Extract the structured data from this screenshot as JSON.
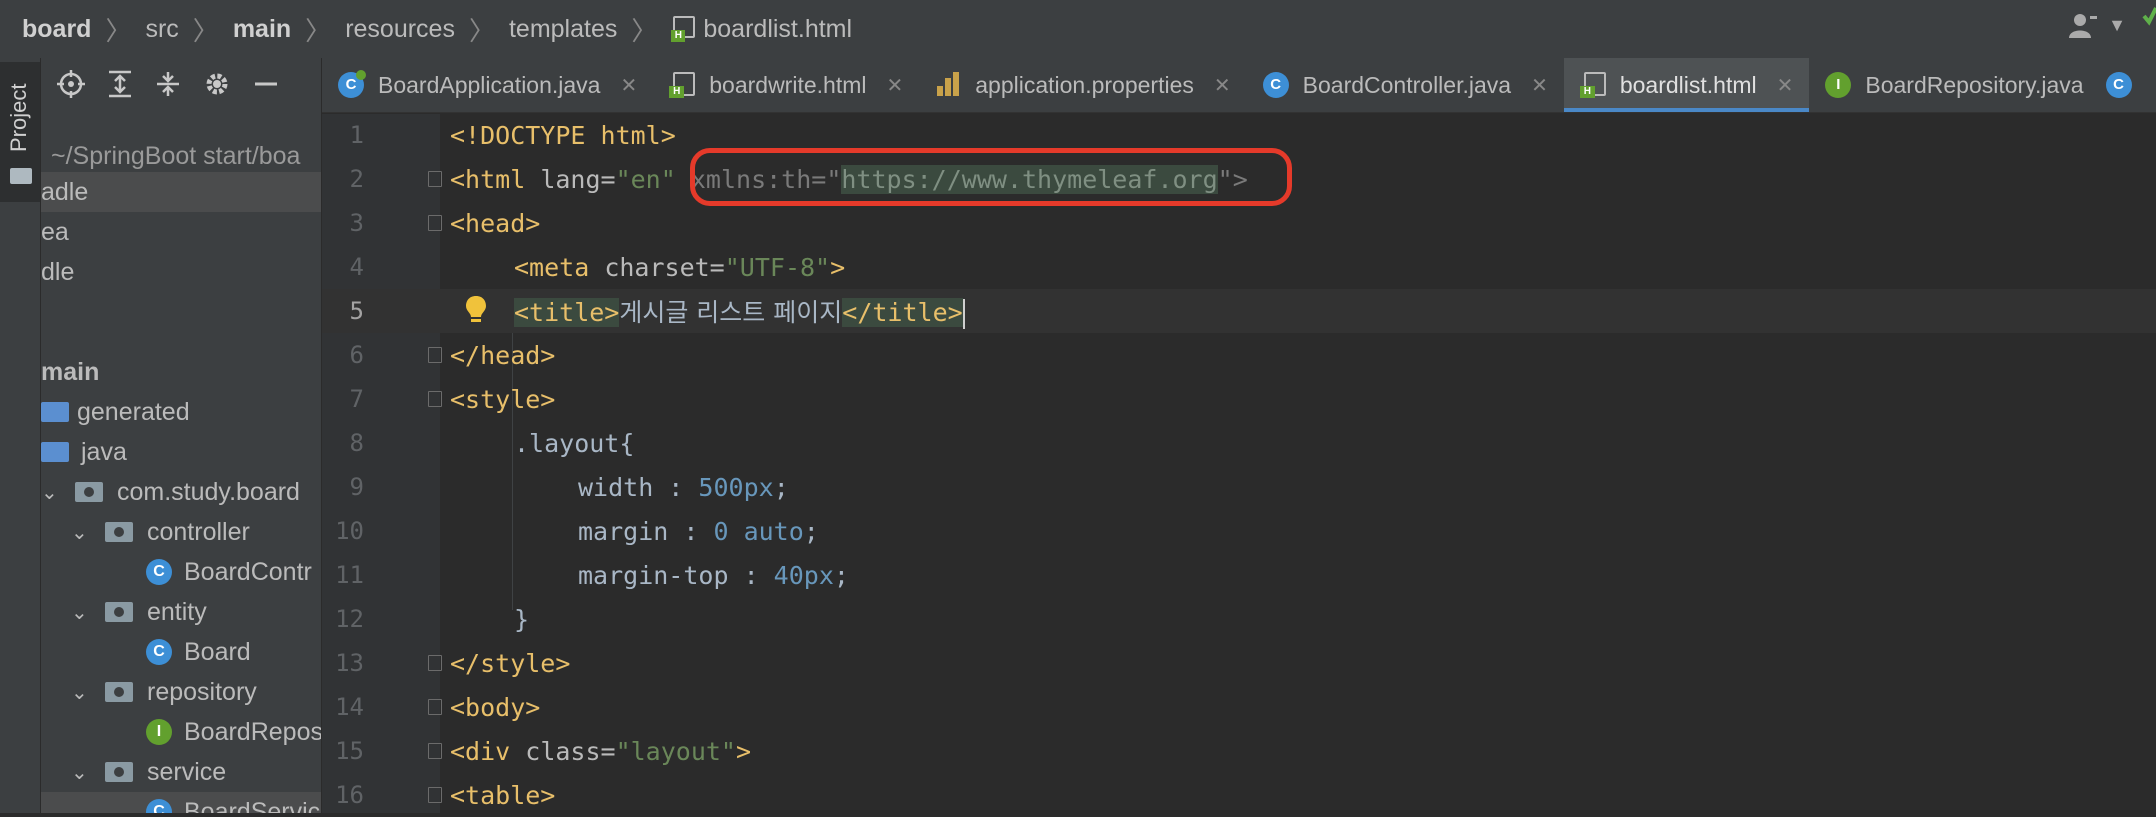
{
  "breadcrumb": {
    "items": [
      "board",
      "src",
      "main",
      "resources",
      "templates",
      "boardlist.html"
    ]
  },
  "sidebar": {
    "project_tab_label": "Project",
    "path": "~/SpringBoot start/boa",
    "items": [
      {
        "label": "adle"
      },
      {
        "label": "ea"
      },
      {
        "label": "dle"
      },
      {
        "label": "main"
      },
      {
        "label": "generated"
      },
      {
        "label": "java"
      },
      {
        "label": "com.study.board"
      },
      {
        "label": "controller"
      },
      {
        "label": "BoardContr"
      },
      {
        "label": "entity"
      },
      {
        "label": "Board"
      },
      {
        "label": "repository"
      },
      {
        "label": "BoardRepos"
      },
      {
        "label": "service"
      },
      {
        "label": "BoardServic"
      }
    ]
  },
  "tabs": [
    {
      "label": "BoardApplication.java",
      "icon": "spring-class-icon"
    },
    {
      "label": "boardwrite.html",
      "icon": "html-file-icon"
    },
    {
      "label": "application.properties",
      "icon": "properties-file-icon"
    },
    {
      "label": "BoardController.java",
      "icon": "class-icon"
    },
    {
      "label": "boardlist.html",
      "icon": "html-file-icon",
      "active": true
    },
    {
      "label": "BoardRepository.java",
      "icon": "interface-icon"
    }
  ],
  "editor": {
    "current_line": 5,
    "lines": [
      {
        "n": "1"
      },
      {
        "n": "2"
      },
      {
        "n": "3"
      },
      {
        "n": "4"
      },
      {
        "n": "5"
      },
      {
        "n": "6"
      },
      {
        "n": "7"
      },
      {
        "n": "8"
      },
      {
        "n": "9"
      },
      {
        "n": "10"
      },
      {
        "n": "11"
      },
      {
        "n": "12"
      },
      {
        "n": "13"
      },
      {
        "n": "14"
      },
      {
        "n": "15"
      },
      {
        "n": "16"
      }
    ],
    "code": {
      "l1": "<!DOCTYPE html>",
      "l2_open": "<html",
      "l2_attr": " lang=",
      "l2_val": "\"en\"",
      "l2_xmlns": "xmlns:th=\"",
      "l2_url": "https://www.thymeleaf.org",
      "l2_end": "\">",
      "l3": "<head>",
      "l4_tag": "<meta",
      "l4_attr": " charset=",
      "l4_val": "\"UTF-8\"",
      "l4_end": ">",
      "l5_open": "<title>",
      "l5_text": "게시글 리스트 페이지",
      "l5_close": "</title>",
      "l6": "</head>",
      "l7": "<style>",
      "l8": ".layout{",
      "l9_prop": "width : ",
      "l9_val": "500px",
      "l9_end": ";",
      "l10_prop": "margin : ",
      "l10_val": "0 auto",
      "l10_end": ";",
      "l11_prop": "margin-top : ",
      "l11_val": "40px",
      "l11_end": ";",
      "l12": "}",
      "l13": "</style>",
      "l14": "<body>",
      "l15_tag": "<div",
      "l15_attr": " class=",
      "l15_val": "\"layout\"",
      "l15_end": ">",
      "l16": "<table>"
    }
  }
}
